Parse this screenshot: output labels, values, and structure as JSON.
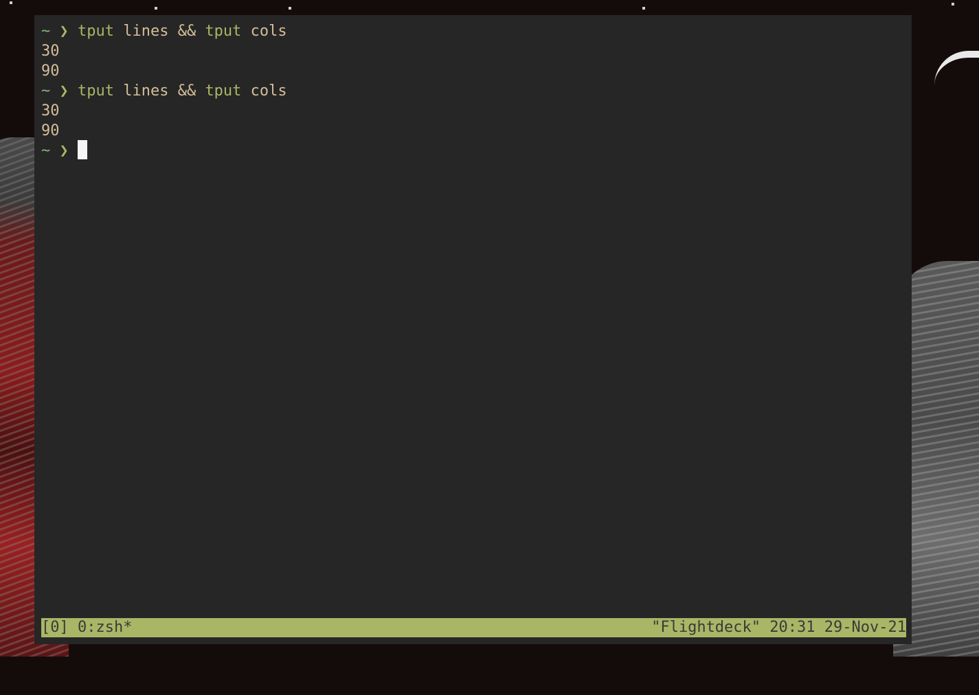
{
  "terminal": {
    "lines": [
      {
        "type": "prompt",
        "dir": "~",
        "symbol": "❯",
        "bin": "tput",
        "args": " lines && ",
        "bin2": "tput",
        "args2": " cols"
      },
      {
        "type": "output",
        "text": "30"
      },
      {
        "type": "output",
        "text": "90"
      },
      {
        "type": "prompt",
        "dir": "~",
        "symbol": "❯",
        "bin": "tput",
        "args": " lines && ",
        "bin2": "tput",
        "args2": " cols"
      },
      {
        "type": "output",
        "text": "30"
      },
      {
        "type": "output",
        "text": "90"
      },
      {
        "type": "prompt",
        "dir": "~",
        "symbol": "❯",
        "bin": "",
        "args": "",
        "bin2": "",
        "args2": ""
      }
    ]
  },
  "statusbar": {
    "session": "[0]",
    "window": "0:zsh*",
    "host": "\"Flightdeck\"",
    "time": "20:31",
    "date": "29-Nov-21"
  },
  "colors": {
    "terminal_bg": "#262626",
    "prompt_dir": "#89b482",
    "prompt_symbol": "#a9b665",
    "output_text": "#d4be98",
    "status_bg": "#a9b665",
    "status_fg": "#3a3a3a"
  }
}
